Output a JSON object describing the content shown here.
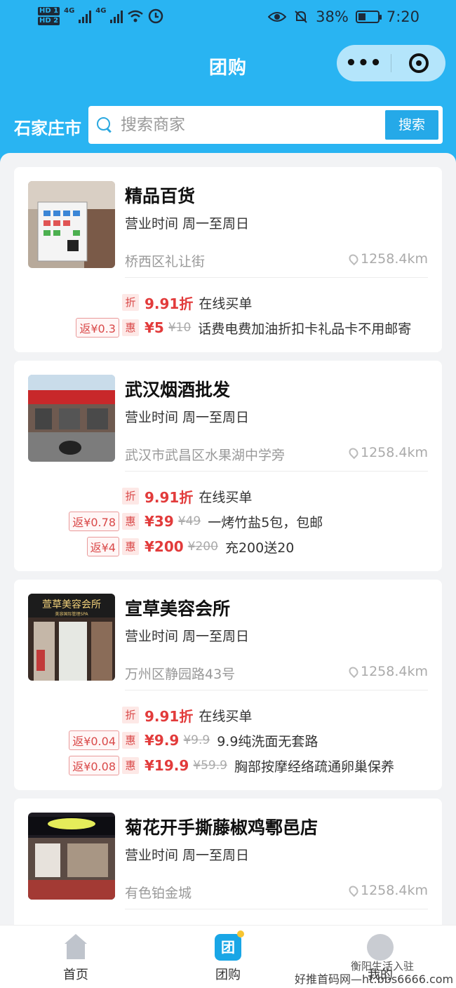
{
  "status_bar": {
    "hd1": "HD 1",
    "hd2": "HD 2",
    "net1": "4G",
    "net2": "4G",
    "battery": "38%",
    "battery_level": 0.38,
    "time": "7:20"
  },
  "header": {
    "title": "团购",
    "menu_dots": "•••",
    "city": "石家庄市",
    "search_placeholder": "搜索商家",
    "search_button": "搜索"
  },
  "stores": [
    {
      "name": "精品百货",
      "hours": "营业时间 周一至周日",
      "address": "桥西区礼让街",
      "distance": "1258.4km",
      "discount": {
        "tag": "折",
        "rate": "9.91折",
        "label": "在线买单"
      },
      "deals": [
        {
          "rebate": "返¥0.3",
          "tag": "惠",
          "price": "¥5",
          "original": "¥10",
          "desc": "话费电费加油折扣卡礼品卡不用邮寄"
        }
      ]
    },
    {
      "name": "武汉烟酒批发",
      "hours": "营业时间 周一至周日",
      "address": "武汉市武昌区水果湖中学旁",
      "distance": "1258.4km",
      "discount": {
        "tag": "折",
        "rate": "9.91折",
        "label": "在线买单"
      },
      "deals": [
        {
          "rebate": "返¥0.78",
          "tag": "惠",
          "price": "¥39",
          "original": "¥49",
          "desc": "一烤竹盐5包，包邮"
        },
        {
          "rebate": "返¥4",
          "tag": "惠",
          "price": "¥200",
          "original": "¥200",
          "desc": "充200送20"
        }
      ]
    },
    {
      "name": "宣草美容会所",
      "hours": "营业时间 周一至周日",
      "address": "万州区静园路43号",
      "distance": "1258.4km",
      "discount": {
        "tag": "折",
        "rate": "9.91折",
        "label": "在线买单"
      },
      "deals": [
        {
          "rebate": "返¥0.04",
          "tag": "惠",
          "price": "¥9.9",
          "original": "¥9.9",
          "desc": "9.9纯洗面无套路"
        },
        {
          "rebate": "返¥0.08",
          "tag": "惠",
          "price": "¥19.9",
          "original": "¥59.9",
          "desc": "胸部按摩经络疏通卵巢保养"
        }
      ]
    },
    {
      "name": "菊花开手撕藤椒鸡鄠邑店",
      "hours": "营业时间 周一至周日",
      "address": "有色铂金城",
      "distance": "1258.4km"
    }
  ],
  "thumb_text": {
    "store3_sign": "萱草美容会所",
    "store3_sub": "美容国际管理SPA"
  },
  "tabbar": {
    "home": "首页",
    "group": "团购",
    "group_icon": "团",
    "me": "我的"
  },
  "watermark": {
    "line1": "衡阳生活入驻",
    "line2": "好推首码网—ht.bbs6666.com"
  },
  "colors": {
    "primary": "#29b4f2",
    "price_red": "#e23b3b"
  }
}
